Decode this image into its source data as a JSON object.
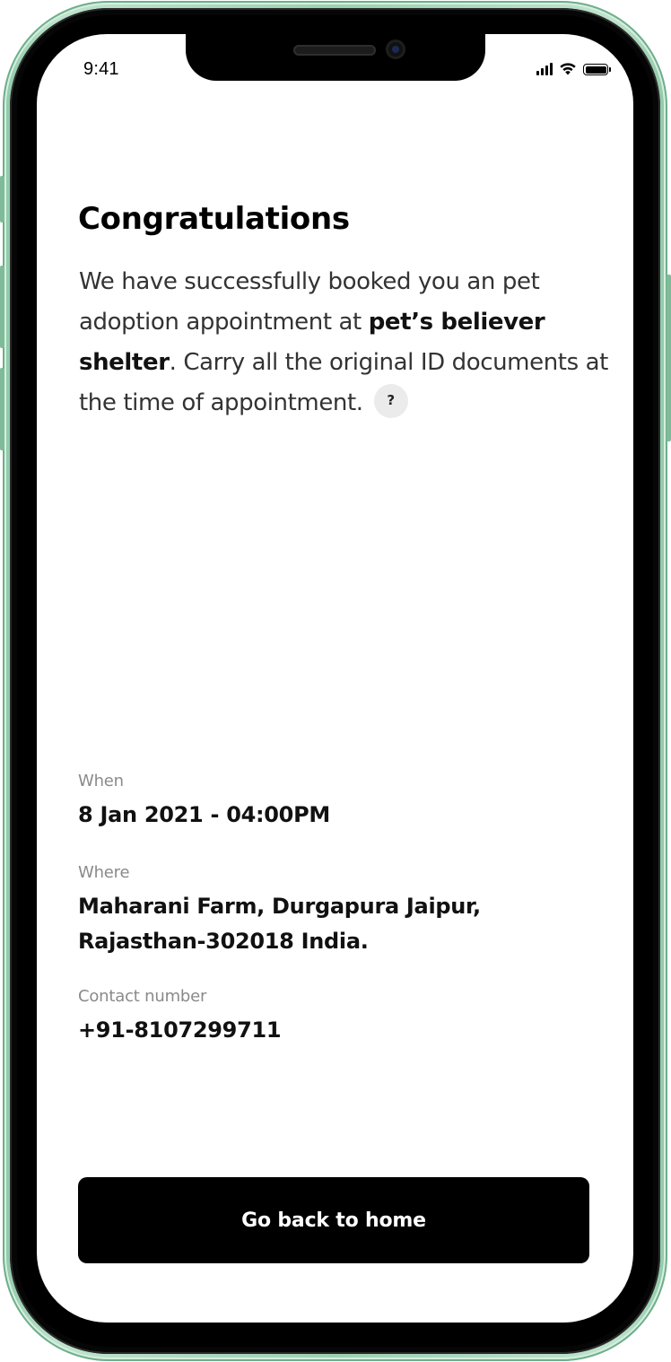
{
  "status_bar": {
    "time": "9:41",
    "icons": [
      "cellular-signal-icon",
      "wifi-icon",
      "battery-icon"
    ]
  },
  "confirmation": {
    "title": "Congratulations",
    "message_part1": "We have successfully booked you an pet adoption appointment at ",
    "shelter_name": "pet’s believer shelter",
    "message_part2": ". Carry all the original ID documents at the time of appointment.",
    "help_icon_label": "?"
  },
  "details": {
    "when_label": "When",
    "when_value": "8 Jan 2021 - 04:00PM",
    "where_label": "Where",
    "where_value_line1": "Maharani Farm, Durgapura Jaipur,",
    "where_value_line2": "Rajasthan-302018 India.",
    "contact_label": "Contact number",
    "contact_value": "+91-8107299711"
  },
  "actions": {
    "home_button_label": "Go back to home"
  },
  "colors": {
    "frame_accent": "#9bd1b1",
    "primary_button": "#000000",
    "label_gray": "#8a8a8a"
  }
}
